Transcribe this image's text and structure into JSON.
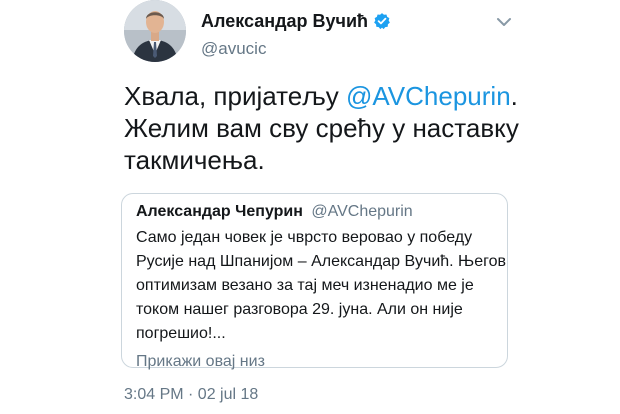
{
  "tweet": {
    "display_name": "Александар Вучић",
    "handle": "@avucic",
    "verified_icon": "verified-badge-icon",
    "menu_icon": "chevron-down-icon",
    "text_before": "Хвала, пријатељу ",
    "mention": "@AVChepurin",
    "text_after": ". Желим вам сву срећу у наставку такмичења.",
    "timestamp": "3:04 PM · 02 jul 18",
    "accent_color": "#1b95e0"
  },
  "quote": {
    "display_name": "Александар Чепурин",
    "handle": "@AVChepurin",
    "text": "Само један човек је чврсто веровао у победу Русије над Шпанијом – Александар Вучић. Његов оптимизам везано за тај меч изненадио ме је током нашег разговора 29. јуна. Али он није погрешио!...",
    "show_thread": "Прикажи овај низ"
  }
}
